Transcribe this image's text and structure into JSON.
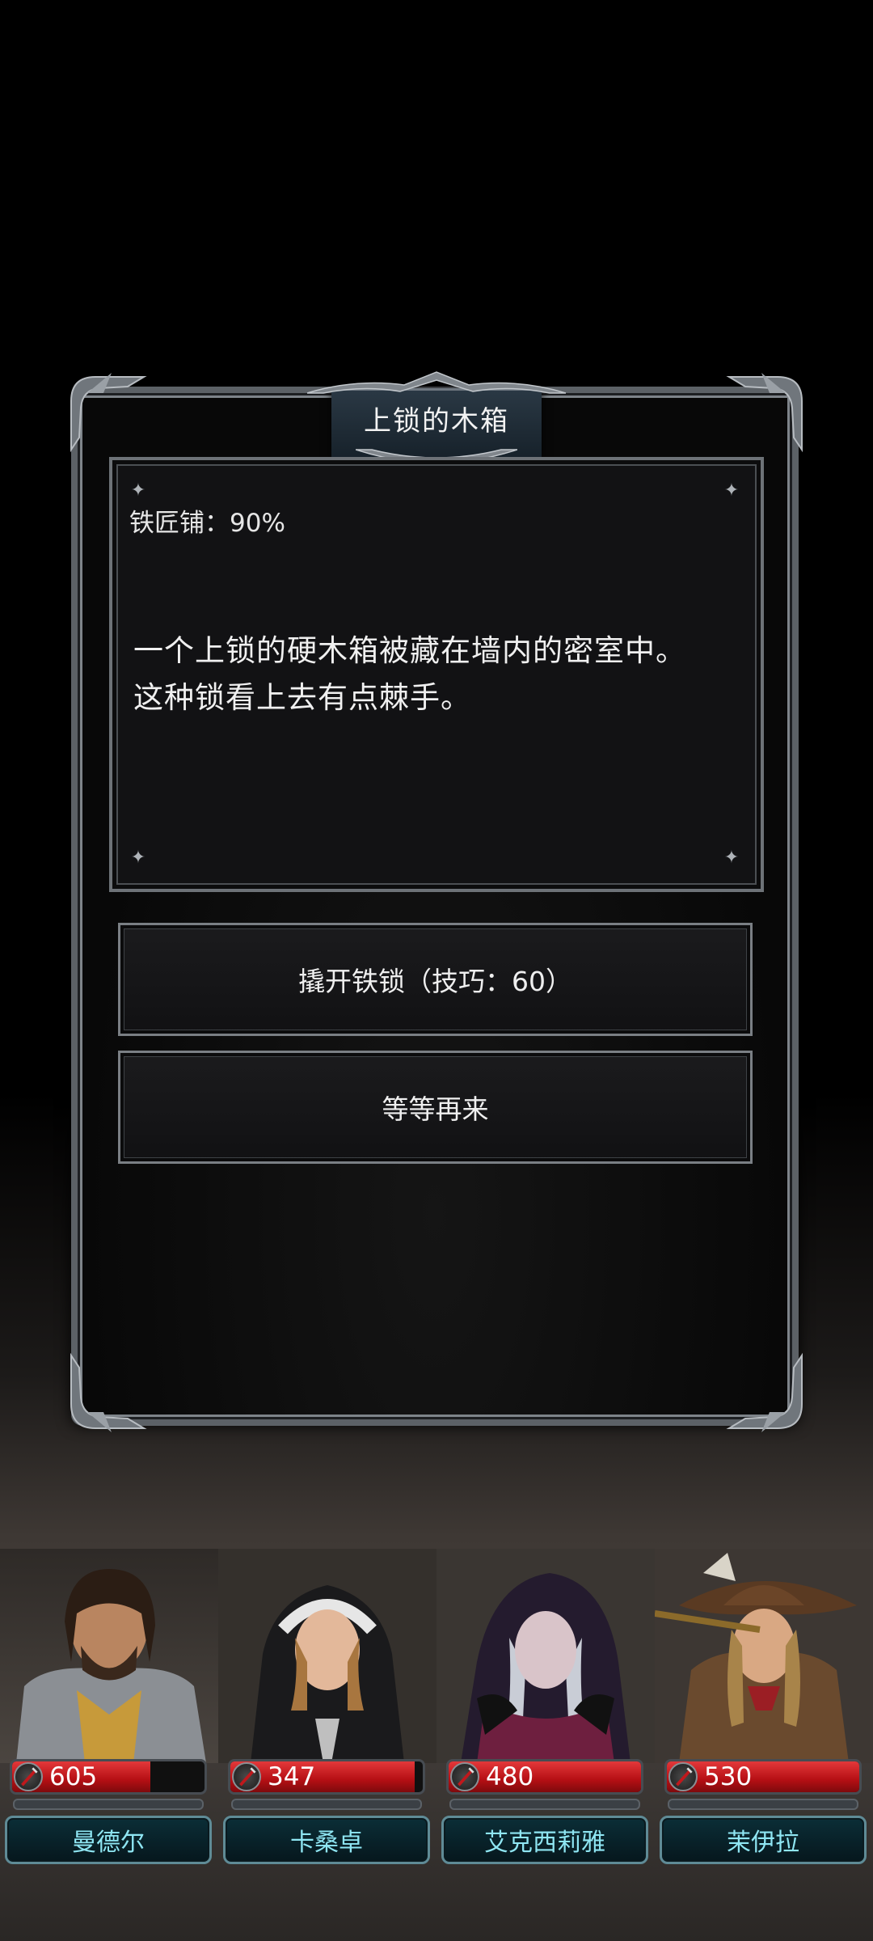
{
  "event": {
    "title": "上锁的木箱",
    "location": "铁匠铺：90%",
    "description": [
      "一个上锁的硬木箱被藏在墙内的密室中。",
      "这种锁看上去有点棘手。"
    ]
  },
  "options": [
    {
      "label": "撬开铁锁（技巧：60）"
    },
    {
      "label": "等等再来"
    }
  ],
  "party": [
    {
      "name": "曼德尔",
      "hp": "605",
      "hp_fraction": 0.72,
      "portrait": "armored-man-portrait"
    },
    {
      "name": "卡桑卓",
      "hp": "347",
      "hp_fraction": 0.96,
      "portrait": "nun-portrait"
    },
    {
      "name": "艾克西莉雅",
      "hp": "480",
      "hp_fraction": 1.0,
      "portrait": "hooded-sorceress-portrait"
    },
    {
      "name": "茉伊拉",
      "hp": "530",
      "hp_fraction": 1.0,
      "portrait": "hunter-portrait"
    }
  ],
  "colors": {
    "hp_red": "#c91a1e",
    "name_text": "#8fe6f3",
    "frame_silver": "#6d7277"
  },
  "icons": {
    "hp": "blood-drop-icon",
    "corner": "sparkle-icon"
  }
}
